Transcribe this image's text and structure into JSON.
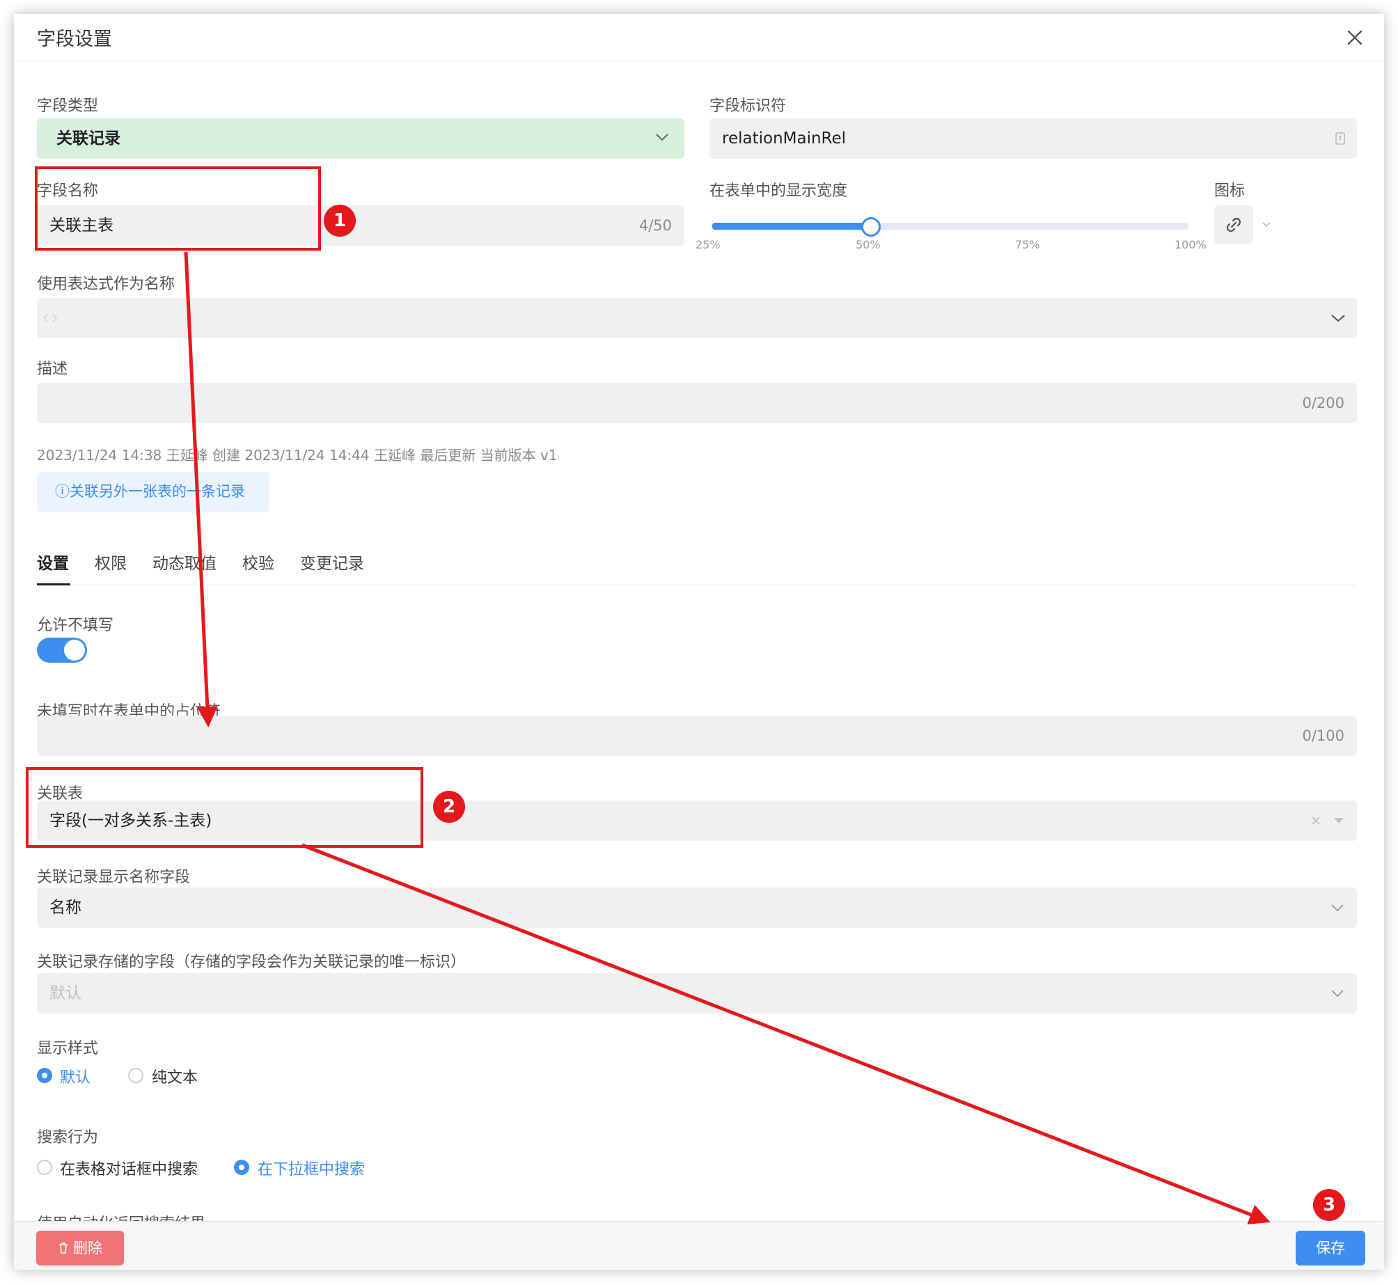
{
  "dialog": {
    "title": "字段设置",
    "close_icon": "close-icon"
  },
  "field_type": {
    "label": "字段类型",
    "value": "关联记录"
  },
  "field_identifier": {
    "label": "字段标识符",
    "value": "relationMainRel"
  },
  "field_name": {
    "label": "字段名称",
    "value": "关联主表",
    "counter": "4/50"
  },
  "display_width": {
    "label": "在表单中的显示宽度",
    "ticks": [
      "25%",
      "50%",
      "75%",
      "100%"
    ],
    "value_percent": 50
  },
  "icon_picker": {
    "label": "图标",
    "icon": "link-icon"
  },
  "expression_name": {
    "label": "使用表达式作为名称",
    "icon": "code-icon"
  },
  "description": {
    "label": "描述",
    "counter": "0/200"
  },
  "meta_line": "2023/11/24 14:38 王延峰 创建 2023/11/24 14:44 王延峰 最后更新 当前版本 v1",
  "info_button": "ⓘ关联另外一张表的一条记录",
  "tabs": [
    "设置",
    "权限",
    "动态取值",
    "校验",
    "变更记录"
  ],
  "allow_empty": {
    "label": "允许不填写",
    "on": true
  },
  "placeholder_field": {
    "label": "未填写时在表单中的占位符",
    "counter": "0/100"
  },
  "related_table": {
    "label": "关联表",
    "value": "字段(一对多关系-主表)"
  },
  "display_name_field": {
    "label": "关联记录显示名称字段",
    "value": "名称"
  },
  "storage_field": {
    "label": "关联记录存储的字段（存储的字段会作为关联记录的唯一标识）",
    "placeholder": "默认"
  },
  "display_style": {
    "label": "显示样式",
    "options": [
      "默认",
      "纯文本"
    ],
    "selected": "默认"
  },
  "search_behavior": {
    "label": "搜索行为",
    "options": [
      "在表格对话框中搜索",
      "在下拉框中搜索"
    ],
    "selected": "在下拉框中搜索"
  },
  "clipped_label": "使用自动化返回搜索结果",
  "footer": {
    "delete": "删除",
    "save": "保存"
  },
  "annotations": [
    "1",
    "2",
    "3"
  ],
  "colors": {
    "accent": "#3d8ef0",
    "annotation": "#e5191c",
    "field_type_bg": "#d9efde",
    "delete": "#f07474"
  }
}
